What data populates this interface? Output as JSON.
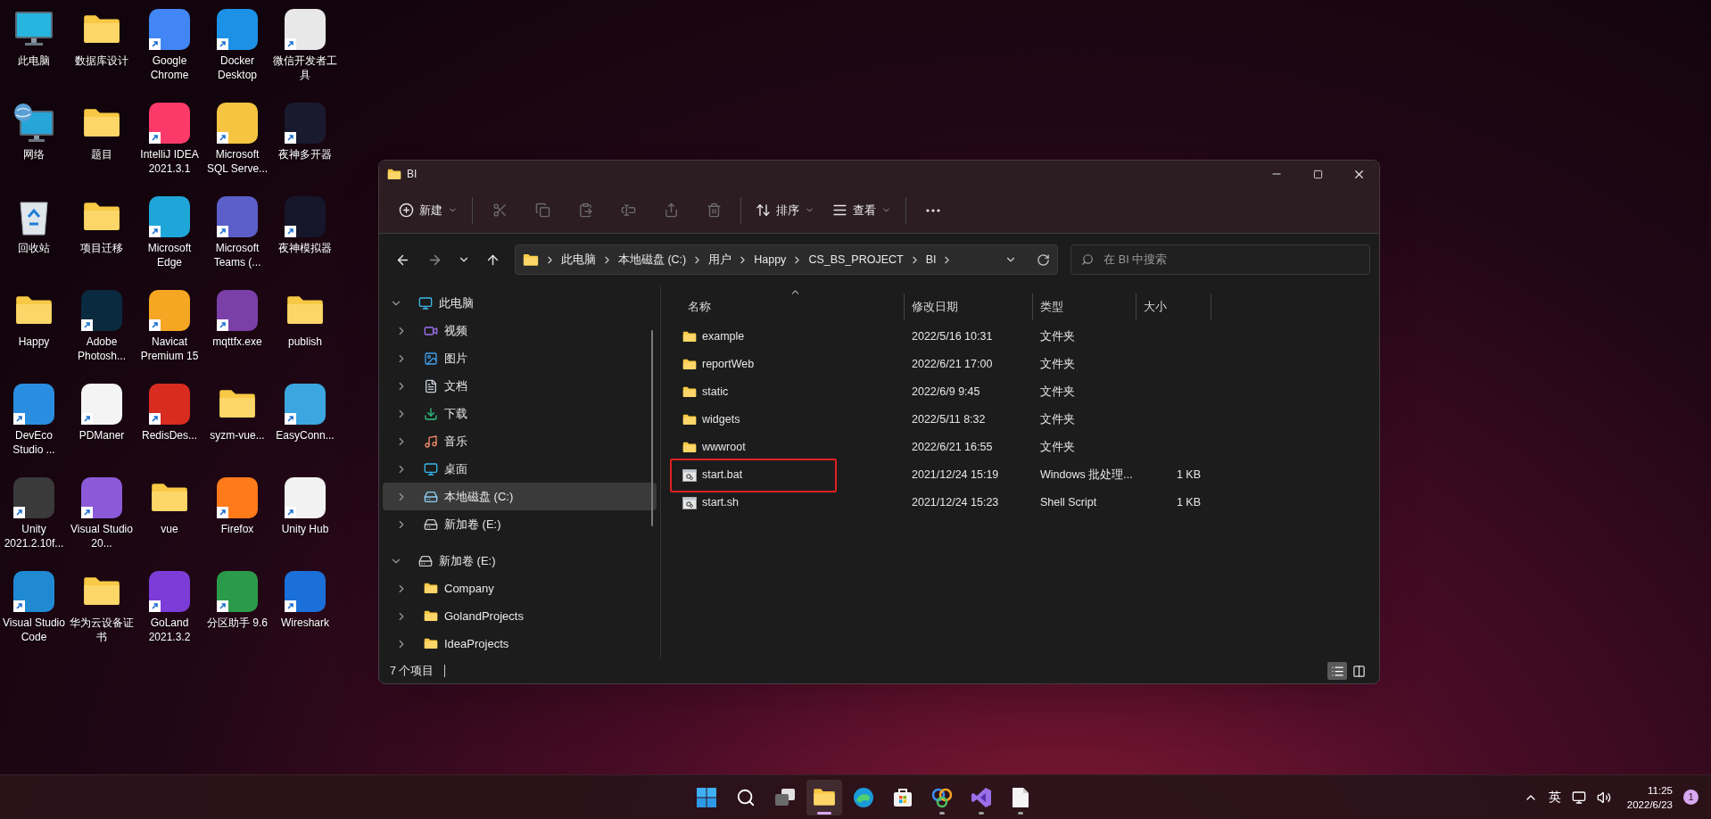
{
  "desktop": {
    "icons": [
      {
        "label": "此电脑",
        "kind": "pc",
        "shortcut": false
      },
      {
        "label": "数据库设计",
        "kind": "folder",
        "shortcut": false
      },
      {
        "label": "Google Chrome",
        "kind": "app",
        "shortcut": true,
        "color": "#4285f4"
      },
      {
        "label": "Docker Desktop",
        "kind": "app",
        "shortcut": true,
        "color": "#1d91e6"
      },
      {
        "label": "微信开发者工具",
        "kind": "app",
        "shortcut": true,
        "color": "#e8e8e8"
      },
      {
        "label": "网络",
        "kind": "network",
        "shortcut": false
      },
      {
        "label": "题目",
        "kind": "folder",
        "shortcut": false
      },
      {
        "label": "IntelliJ IDEA 2021.3.1",
        "kind": "app",
        "shortcut": true,
        "color": "#fc3a6a"
      },
      {
        "label": "Microsoft SQL Serve...",
        "kind": "app",
        "shortcut": true,
        "color": "#f5c542"
      },
      {
        "label": "夜神多开器",
        "kind": "app",
        "shortcut": true,
        "color": "#1a1a2e"
      },
      {
        "label": "回收站",
        "kind": "recycle",
        "shortcut": false
      },
      {
        "label": "项目迁移",
        "kind": "folder",
        "shortcut": false
      },
      {
        "label": "Microsoft Edge",
        "kind": "app",
        "shortcut": true,
        "color": "#1fa6d8"
      },
      {
        "label": "Microsoft Teams (...",
        "kind": "app",
        "shortcut": true,
        "color": "#5b5fc7"
      },
      {
        "label": "夜神模拟器",
        "kind": "app",
        "shortcut": true,
        "color": "#16162a"
      },
      {
        "label": "Happy",
        "kind": "folder",
        "shortcut": false
      },
      {
        "label": "Adobe Photosh...",
        "kind": "app",
        "shortcut": true,
        "color": "#0a2a40"
      },
      {
        "label": "Navicat Premium 15",
        "kind": "app",
        "shortcut": true,
        "color": "#f5a623"
      },
      {
        "label": "mqttfx.exe",
        "kind": "app",
        "shortcut": true,
        "color": "#7b3fa8"
      },
      {
        "label": "publish",
        "kind": "folder",
        "shortcut": false
      },
      {
        "label": "DevEco Studio ...",
        "kind": "app",
        "shortcut": true,
        "color": "#2a8ee0"
      },
      {
        "label": "PDManer",
        "kind": "app",
        "shortcut": true,
        "color": "#f4f4f4"
      },
      {
        "label": "RedisDes...",
        "kind": "app",
        "shortcut": true,
        "color": "#d82c20"
      },
      {
        "label": "syzm-vue...",
        "kind": "folder",
        "shortcut": false
      },
      {
        "label": "EasyConn...",
        "kind": "app",
        "shortcut": true,
        "color": "#3ba6e0"
      },
      {
        "label": "Unity 2021.2.10f...",
        "kind": "app",
        "shortcut": true,
        "color": "#3a3a3a"
      },
      {
        "label": "Visual Studio 20...",
        "kind": "app",
        "shortcut": true,
        "color": "#8c5ad8"
      },
      {
        "label": "vue",
        "kind": "folder",
        "shortcut": false
      },
      {
        "label": "Firefox",
        "kind": "app",
        "shortcut": true,
        "color": "#ff7a1a"
      },
      {
        "label": "Unity Hub",
        "kind": "app",
        "shortcut": true,
        "color": "#f2f2f2"
      },
      {
        "label": "Visual Studio Code",
        "kind": "app",
        "shortcut": true,
        "color": "#1f8ad2"
      },
      {
        "label": "华为云设备证书",
        "kind": "folder",
        "shortcut": false
      },
      {
        "label": "GoLand 2021.3.2",
        "kind": "app",
        "shortcut": true,
        "color": "#7c3cd8"
      },
      {
        "label": "分区助手 9.6",
        "kind": "app",
        "shortcut": true,
        "color": "#2b9a4a"
      },
      {
        "label": "Wireshark",
        "kind": "app",
        "shortcut": true,
        "color": "#1b6fd8"
      }
    ]
  },
  "window": {
    "title": "BI",
    "toolbar": [
      {
        "kind": "new",
        "label": "新建",
        "disabled": false
      },
      {
        "kind": "cut",
        "disabled": true
      },
      {
        "kind": "copy",
        "disabled": true
      },
      {
        "kind": "paste",
        "disabled": true
      },
      {
        "kind": "rename",
        "disabled": true
      },
      {
        "kind": "share",
        "disabled": true
      },
      {
        "kind": "delete",
        "disabled": true
      },
      {
        "kind": "sort",
        "label": "排序",
        "disabled": false
      },
      {
        "kind": "view",
        "label": "查看",
        "disabled": false
      },
      {
        "kind": "more",
        "disabled": false
      }
    ],
    "breadcrumbs": [
      "此电脑",
      "本地磁盘 (C:)",
      "用户",
      "Happy",
      "CS_BS_PROJECT",
      "BI"
    ],
    "search": {
      "placeholder": "在 BI 中搜索"
    },
    "nav_tree": [
      {
        "label": "此电脑",
        "kind": "pc",
        "expanded": true,
        "selected": false,
        "children": [
          {
            "label": "视频",
            "kind": "videos",
            "expanded": false,
            "selected": false
          },
          {
            "label": "图片",
            "kind": "pictures",
            "expanded": false,
            "selected": false
          },
          {
            "label": "文档",
            "kind": "documents",
            "expanded": false,
            "selected": false
          },
          {
            "label": "下载",
            "kind": "downloads",
            "expanded": false,
            "selected": false
          },
          {
            "label": "音乐",
            "kind": "music",
            "expanded": false,
            "selected": false
          },
          {
            "label": "桌面",
            "kind": "desktop",
            "expanded": false,
            "selected": false
          },
          {
            "label": "本地磁盘 (C:)",
            "kind": "system-drive",
            "expanded": false,
            "selected": true
          },
          {
            "label": "新加卷 (E:)",
            "kind": "drive",
            "expanded": false,
            "selected": false
          }
        ]
      },
      {
        "label": "新加卷 (E:)",
        "kind": "drive",
        "expanded": true,
        "selected": false,
        "children": [
          {
            "label": "Company",
            "kind": "folder",
            "expanded": false,
            "selected": false
          },
          {
            "label": "GolandProjects",
            "kind": "folder",
            "expanded": false,
            "selected": false
          },
          {
            "label": "IdeaProjects",
            "kind": "folder",
            "expanded": false,
            "selected": false
          }
        ]
      }
    ],
    "columns": [
      {
        "label": "名称",
        "sorted": true
      },
      {
        "label": "修改日期",
        "sorted": false
      },
      {
        "label": "类型",
        "sorted": false
      },
      {
        "label": "大小",
        "sorted": false
      }
    ],
    "files": [
      {
        "name": "example",
        "kind": "folder",
        "modified": "2022/5/16 10:31",
        "type": "文件夹",
        "annotated": false
      },
      {
        "name": "reportWeb",
        "kind": "folder",
        "modified": "2022/6/21 17:00",
        "type": "文件夹",
        "annotated": false
      },
      {
        "name": "static",
        "kind": "folder",
        "modified": "2022/6/9 9:45",
        "type": "文件夹",
        "annotated": false
      },
      {
        "name": "widgets",
        "kind": "folder",
        "modified": "2022/5/11 8:32",
        "type": "文件夹",
        "annotated": false
      },
      {
        "name": "wwwroot",
        "kind": "folder",
        "modified": "2022/6/21 16:55",
        "type": "文件夹",
        "annotated": false
      },
      {
        "name": "start.bat",
        "kind": "script",
        "modified": "2021/12/24 15:19",
        "type": "Windows 批处理...",
        "size": "1 KB",
        "annotated": true
      },
      {
        "name": "start.sh",
        "kind": "script",
        "modified": "2021/12/24 15:23",
        "type": "Shell Script",
        "size": "1 KB",
        "annotated": false
      }
    ],
    "status_bar": {
      "count": "7 个项目",
      "views": [
        {
          "kind": "details",
          "selected": true
        },
        {
          "kind": "large-icons",
          "selected": false
        }
      ]
    }
  },
  "taskbar": {
    "items": [
      {
        "kind": "start",
        "active": false,
        "running": false
      },
      {
        "kind": "search",
        "active": false,
        "running": false
      },
      {
        "kind": "task-view",
        "active": false,
        "running": false
      },
      {
        "kind": "explorer",
        "active": true,
        "running": true
      },
      {
        "kind": "edge",
        "active": false,
        "running": false
      },
      {
        "kind": "store",
        "active": false,
        "running": false
      },
      {
        "kind": "navicat",
        "active": false,
        "running": true
      },
      {
        "kind": "visual-studio",
        "active": false,
        "running": true
      },
      {
        "kind": "notepad",
        "active": false,
        "running": true
      }
    ],
    "input_method": "英",
    "time": "11:25",
    "date": "2022/6/23",
    "notifications": "1"
  }
}
